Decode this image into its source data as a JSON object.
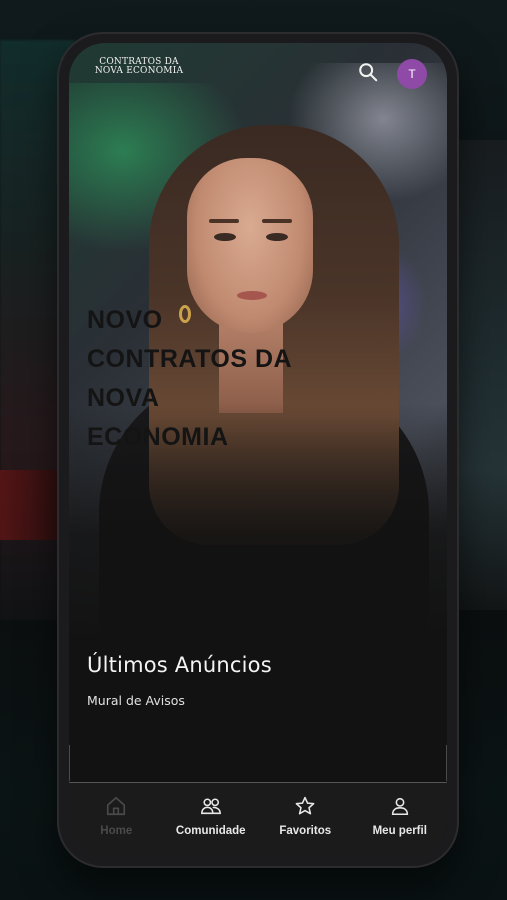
{
  "app": {
    "logo": {
      "kicker": "",
      "line1": "CONTRATOS DA",
      "line2": "NOVA ECONOMIA"
    },
    "avatar_initial": "T",
    "colors": {
      "avatar": "#8e4aa6",
      "background": "#121212",
      "nav_background": "#1b1b1c"
    }
  },
  "hero": {
    "title": "NOVO CONTRATOS DA NOVA ECONOMIA"
  },
  "announcements": {
    "title": "Últimos Anúncios",
    "subtitle": "Mural de Avisos"
  },
  "bottom_nav": {
    "items": [
      {
        "label": "Home",
        "icon": "home-icon",
        "active": true
      },
      {
        "label": "Comunidade",
        "icon": "users-icon",
        "active": false
      },
      {
        "label": "Favoritos",
        "icon": "star-icon",
        "active": false
      },
      {
        "label": "Meu perfil",
        "icon": "user-icon",
        "active": false
      }
    ]
  }
}
